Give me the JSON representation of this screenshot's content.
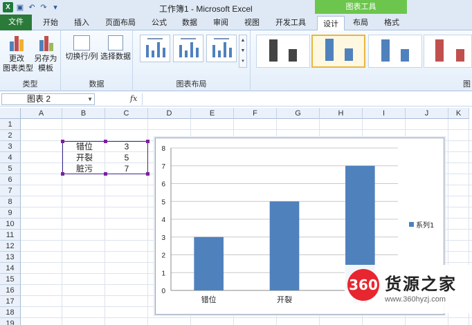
{
  "window": {
    "title": "工作簿1 - Microsoft Excel",
    "context_tab_group": "图表工具"
  },
  "tabs": [
    "文件",
    "开始",
    "插入",
    "页面布局",
    "公式",
    "数据",
    "审阅",
    "视图",
    "开发工具",
    "设计",
    "布局",
    "格式"
  ],
  "active_tab": "设计",
  "ribbon": {
    "type_group": {
      "label": "类型",
      "change_type": "更改\n图表类型",
      "save_template": "另存为\n模板"
    },
    "data_group": {
      "label": "数据",
      "switch_row_col": "切换行/列",
      "select_data": "选择数据"
    },
    "layout_group": {
      "label": "图表布局"
    },
    "styles_group": {
      "label": "图"
    }
  },
  "formula_bar": {
    "name_box": "图表 2",
    "fx": "fx",
    "formula": ""
  },
  "columns": [
    "A",
    "B",
    "C",
    "D",
    "E",
    "F",
    "G",
    "H",
    "I",
    "J",
    "K"
  ],
  "rows": [
    "1",
    "2",
    "3",
    "4",
    "5",
    "6",
    "7",
    "8",
    "9",
    "10",
    "11",
    "12",
    "13",
    "14",
    "15",
    "16",
    "17",
    "18",
    "19"
  ],
  "cells": [
    {
      "ref": "B3",
      "value": "错位"
    },
    {
      "ref": "C3",
      "value": "3"
    },
    {
      "ref": "B4",
      "value": "开裂"
    },
    {
      "ref": "C4",
      "value": "5"
    },
    {
      "ref": "B5",
      "value": "脏污"
    },
    {
      "ref": "C5",
      "value": "7"
    }
  ],
  "colors": {
    "bar": "#4f81bd",
    "file_tab": "#2a7a3a",
    "context_tab": "#6cc64d",
    "selection": "#3a2a8a",
    "handle": "#7a1fa0"
  },
  "chart_data": {
    "type": "bar",
    "categories": [
      "错位",
      "开裂",
      "脏污"
    ],
    "series": [
      {
        "name": "系列1",
        "values": [
          3,
          5,
          7
        ]
      }
    ],
    "ylim": [
      0,
      8
    ],
    "yticks": [
      0,
      1,
      2,
      3,
      4,
      5,
      6,
      7,
      8
    ],
    "grid": true,
    "legend": "right",
    "title": "",
    "xlabel": "",
    "ylabel": ""
  },
  "watermark": {
    "logo": "360",
    "title": "货源之家",
    "url": "www.360hyzj.com"
  }
}
